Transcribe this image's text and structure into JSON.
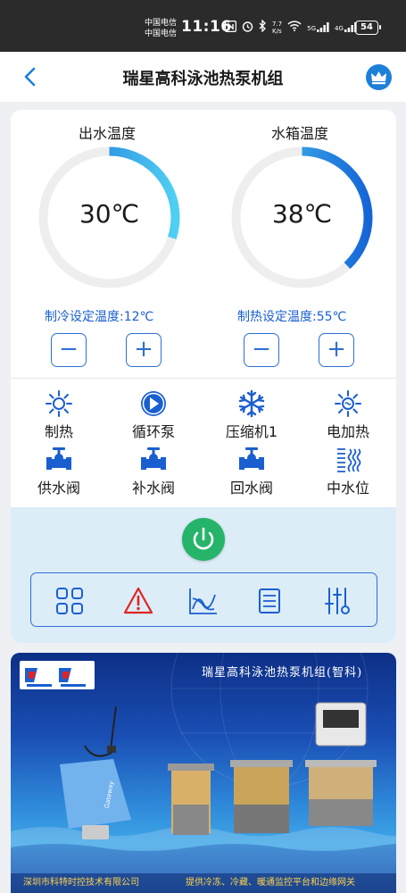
{
  "statusbar": {
    "carrier1": "中国电信",
    "carrier2": "中国电信",
    "time": "11:16",
    "speed_value": "7.7",
    "speed_unit": "K/s",
    "signal1": "5G",
    "signal2": "4G",
    "battery": "54"
  },
  "header": {
    "title": "瑞星高科泳池热泵机组",
    "icon_back": "back-chevron-icon",
    "icon_crown": "crown-icon"
  },
  "gauges": {
    "outlet": {
      "title": "出水温度",
      "value": "30℃",
      "fraction": 0.3
    },
    "tank": {
      "title": "水箱温度",
      "value": "38℃",
      "fraction": 0.38
    }
  },
  "setpoints": {
    "cooling": "制冷设定温度:12℃",
    "heating": "制热设定温度:55℃",
    "minus": "−",
    "plus": "+"
  },
  "devices": [
    {
      "label": "制热",
      "icon": "sun-icon"
    },
    {
      "label": "循环泵",
      "icon": "pump-icon"
    },
    {
      "label": "压缩机1",
      "icon": "snowflake-icon"
    },
    {
      "label": "电加热",
      "icon": "heater-icon"
    },
    {
      "label": "供水阀",
      "icon": "valve-icon"
    },
    {
      "label": "补水阀",
      "icon": "valve-icon"
    },
    {
      "label": "回水阀",
      "icon": "valve-icon"
    },
    {
      "label": "中水位",
      "icon": "water-level-icon"
    }
  ],
  "nav": [
    "grid-icon",
    "alarm-icon",
    "chart-icon",
    "list-icon",
    "settings-sliders-icon"
  ],
  "banner": {
    "brand": "瑞星高科泳池热泵机组(智科)",
    "footer_left": "深圳市科特时控技术有限公司",
    "footer_right": "提供冷冻、冷藏、暖通监控平台和边缘网关",
    "device_label": "Gateway"
  },
  "colors": {
    "accent": "#1a5fd0",
    "gauge_start": "#1565d8",
    "gauge_end": "#4fd0f2",
    "track": "#eeeeee",
    "power": "#25b46a",
    "alarm": "#e02424"
  }
}
